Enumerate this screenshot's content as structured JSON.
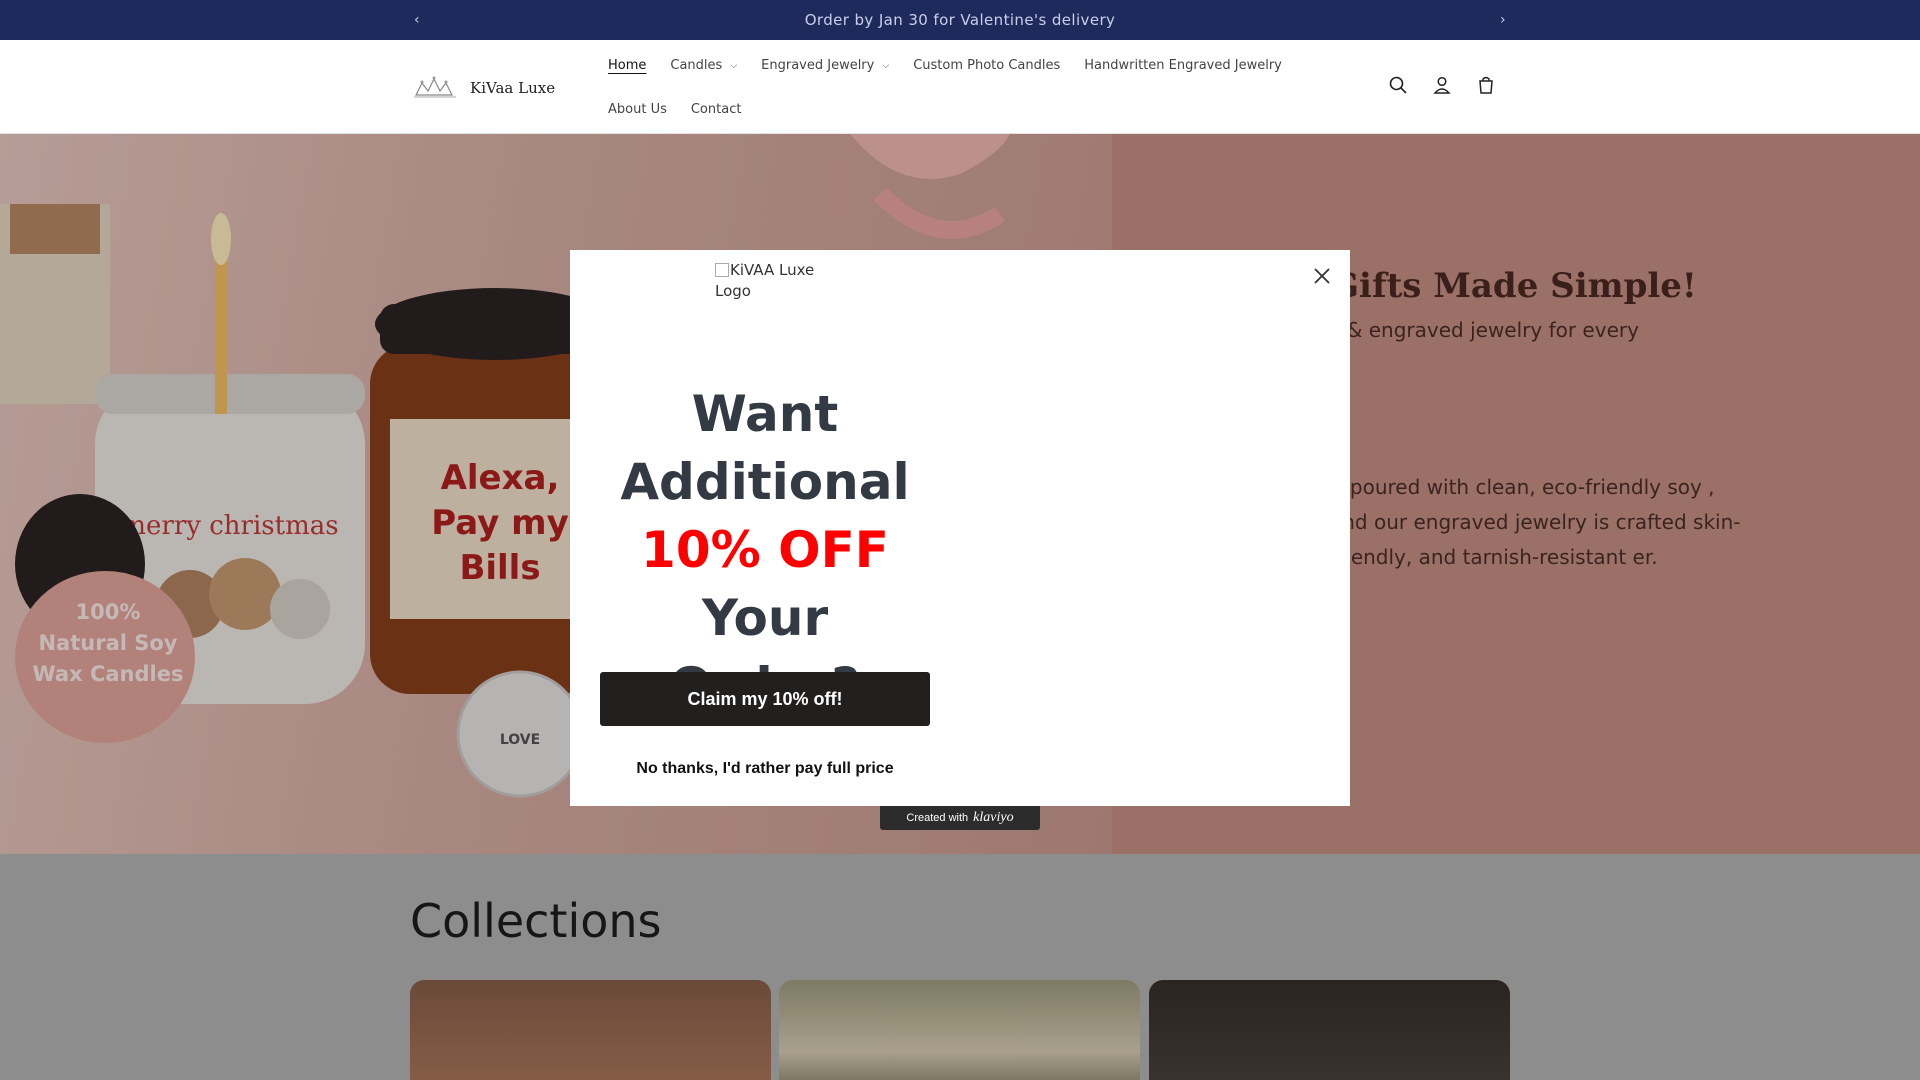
{
  "announcement": {
    "text": "Order by Jan 30 for Valentine's delivery",
    "prev_icon": "chevron-left-icon",
    "next_icon": "chevron-right-icon"
  },
  "header": {
    "logo": {
      "name": "KiVaa Luxe"
    },
    "nav_row1": [
      {
        "label": "Home",
        "active": true,
        "has_dropdown": false
      },
      {
        "label": "Candles",
        "has_dropdown": true
      },
      {
        "label": "Engraved Jewelry",
        "has_dropdown": true
      },
      {
        "label": "Custom Photo Candles",
        "has_dropdown": false
      },
      {
        "label": "Handwritten Engraved Jewelry",
        "has_dropdown": false
      }
    ],
    "nav_row2": [
      {
        "label": "About Us"
      },
      {
        "label": "Contact"
      }
    ],
    "icons": [
      "search-icon",
      "account-icon",
      "cart-icon"
    ]
  },
  "hero": {
    "title": "Gifts Made Simple!",
    "subtitle": "s & engraved jewelry for every",
    "body": "d-poured with clean, eco-friendly soy , and our engraved jewelry is crafted skin-friendly, and tarnish-resistant er.",
    "image_labels": {
      "badge": "100% Natural Soy Wax Candles",
      "candle1": "merry christmas",
      "candle2": "Alexa, Pay my Bills",
      "pendant": "LOVE"
    }
  },
  "collections": {
    "title": "Collections"
  },
  "modal": {
    "logo_alt": "KiVAA Luxe Logo",
    "headline_line1": "Want",
    "headline_line2": "Additional",
    "headline_highlight": "10% OFF",
    "headline_line4": "Your Order?",
    "claim_button": "Claim my 10% off!",
    "decline_link": "No thanks, I'd rather pay full price",
    "close_icon": "close-icon",
    "highlight_color": "#ff0000",
    "button_color": "#221f1f"
  },
  "klaviyo_badge": {
    "prefix": "Created with",
    "brand": "klaviyo"
  },
  "colors": {
    "announcement_bg": "#1f2a5c",
    "hero_bg": "#c79083"
  }
}
